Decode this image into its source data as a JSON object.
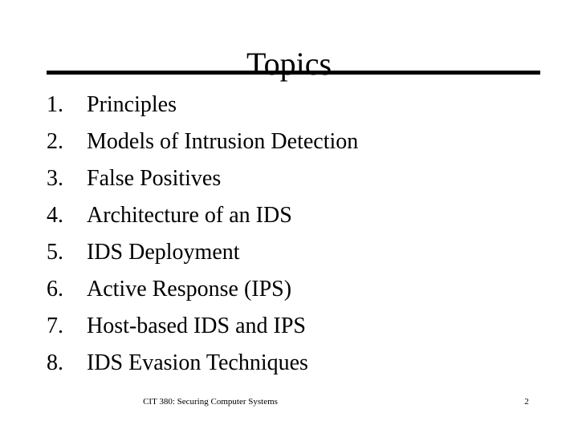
{
  "slide": {
    "title": "Topics",
    "background_color": "#ffffff",
    "text_color": "#000000",
    "rule_color": "#000000"
  },
  "topics": [
    {
      "number": "1.",
      "label": "Principles"
    },
    {
      "number": "2.",
      "label": "Models of Intrusion Detection"
    },
    {
      "number": "3.",
      "label": "False Positives"
    },
    {
      "number": "4.",
      "label": "Architecture of an IDS"
    },
    {
      "number": "5.",
      "label": "IDS Deployment"
    },
    {
      "number": "6.",
      "label": "Active Response (IPS)"
    },
    {
      "number": "7.",
      "label": "Host-based IDS and IPS"
    },
    {
      "number": "8.",
      "label": "IDS Evasion Techniques"
    }
  ],
  "footer": {
    "course": "CIT 380: Securing Computer Systems",
    "page_number": "2"
  }
}
